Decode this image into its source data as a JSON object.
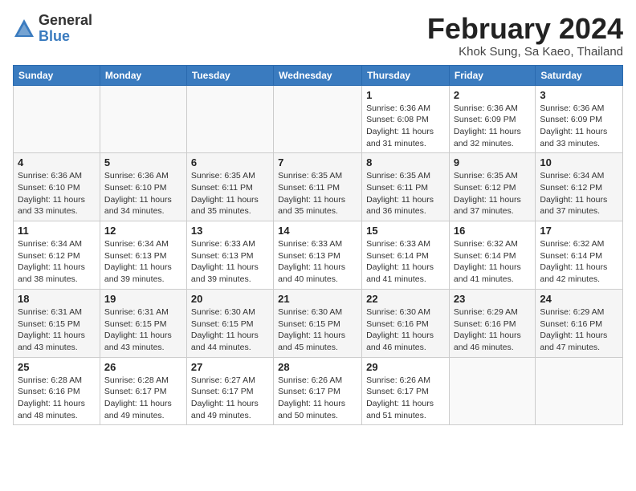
{
  "logo": {
    "general": "General",
    "blue": "Blue"
  },
  "title": {
    "month_year": "February 2024",
    "location": "Khok Sung, Sa Kaeo, Thailand"
  },
  "headers": [
    "Sunday",
    "Monday",
    "Tuesday",
    "Wednesday",
    "Thursday",
    "Friday",
    "Saturday"
  ],
  "weeks": [
    [
      {
        "day": "",
        "info": ""
      },
      {
        "day": "",
        "info": ""
      },
      {
        "day": "",
        "info": ""
      },
      {
        "day": "",
        "info": ""
      },
      {
        "day": "1",
        "info": "Sunrise: 6:36 AM\nSunset: 6:08 PM\nDaylight: 11 hours\nand 31 minutes."
      },
      {
        "day": "2",
        "info": "Sunrise: 6:36 AM\nSunset: 6:09 PM\nDaylight: 11 hours\nand 32 minutes."
      },
      {
        "day": "3",
        "info": "Sunrise: 6:36 AM\nSunset: 6:09 PM\nDaylight: 11 hours\nand 33 minutes."
      }
    ],
    [
      {
        "day": "4",
        "info": "Sunrise: 6:36 AM\nSunset: 6:10 PM\nDaylight: 11 hours\nand 33 minutes."
      },
      {
        "day": "5",
        "info": "Sunrise: 6:36 AM\nSunset: 6:10 PM\nDaylight: 11 hours\nand 34 minutes."
      },
      {
        "day": "6",
        "info": "Sunrise: 6:35 AM\nSunset: 6:11 PM\nDaylight: 11 hours\nand 35 minutes."
      },
      {
        "day": "7",
        "info": "Sunrise: 6:35 AM\nSunset: 6:11 PM\nDaylight: 11 hours\nand 35 minutes."
      },
      {
        "day": "8",
        "info": "Sunrise: 6:35 AM\nSunset: 6:11 PM\nDaylight: 11 hours\nand 36 minutes."
      },
      {
        "day": "9",
        "info": "Sunrise: 6:35 AM\nSunset: 6:12 PM\nDaylight: 11 hours\nand 37 minutes."
      },
      {
        "day": "10",
        "info": "Sunrise: 6:34 AM\nSunset: 6:12 PM\nDaylight: 11 hours\nand 37 minutes."
      }
    ],
    [
      {
        "day": "11",
        "info": "Sunrise: 6:34 AM\nSunset: 6:12 PM\nDaylight: 11 hours\nand 38 minutes."
      },
      {
        "day": "12",
        "info": "Sunrise: 6:34 AM\nSunset: 6:13 PM\nDaylight: 11 hours\nand 39 minutes."
      },
      {
        "day": "13",
        "info": "Sunrise: 6:33 AM\nSunset: 6:13 PM\nDaylight: 11 hours\nand 39 minutes."
      },
      {
        "day": "14",
        "info": "Sunrise: 6:33 AM\nSunset: 6:13 PM\nDaylight: 11 hours\nand 40 minutes."
      },
      {
        "day": "15",
        "info": "Sunrise: 6:33 AM\nSunset: 6:14 PM\nDaylight: 11 hours\nand 41 minutes."
      },
      {
        "day": "16",
        "info": "Sunrise: 6:32 AM\nSunset: 6:14 PM\nDaylight: 11 hours\nand 41 minutes."
      },
      {
        "day": "17",
        "info": "Sunrise: 6:32 AM\nSunset: 6:14 PM\nDaylight: 11 hours\nand 42 minutes."
      }
    ],
    [
      {
        "day": "18",
        "info": "Sunrise: 6:31 AM\nSunset: 6:15 PM\nDaylight: 11 hours\nand 43 minutes."
      },
      {
        "day": "19",
        "info": "Sunrise: 6:31 AM\nSunset: 6:15 PM\nDaylight: 11 hours\nand 43 minutes."
      },
      {
        "day": "20",
        "info": "Sunrise: 6:30 AM\nSunset: 6:15 PM\nDaylight: 11 hours\nand 44 minutes."
      },
      {
        "day": "21",
        "info": "Sunrise: 6:30 AM\nSunset: 6:15 PM\nDaylight: 11 hours\nand 45 minutes."
      },
      {
        "day": "22",
        "info": "Sunrise: 6:30 AM\nSunset: 6:16 PM\nDaylight: 11 hours\nand 46 minutes."
      },
      {
        "day": "23",
        "info": "Sunrise: 6:29 AM\nSunset: 6:16 PM\nDaylight: 11 hours\nand 46 minutes."
      },
      {
        "day": "24",
        "info": "Sunrise: 6:29 AM\nSunset: 6:16 PM\nDaylight: 11 hours\nand 47 minutes."
      }
    ],
    [
      {
        "day": "25",
        "info": "Sunrise: 6:28 AM\nSunset: 6:16 PM\nDaylight: 11 hours\nand 48 minutes."
      },
      {
        "day": "26",
        "info": "Sunrise: 6:28 AM\nSunset: 6:17 PM\nDaylight: 11 hours\nand 49 minutes."
      },
      {
        "day": "27",
        "info": "Sunrise: 6:27 AM\nSunset: 6:17 PM\nDaylight: 11 hours\nand 49 minutes."
      },
      {
        "day": "28",
        "info": "Sunrise: 6:26 AM\nSunset: 6:17 PM\nDaylight: 11 hours\nand 50 minutes."
      },
      {
        "day": "29",
        "info": "Sunrise: 6:26 AM\nSunset: 6:17 PM\nDaylight: 11 hours\nand 51 minutes."
      },
      {
        "day": "",
        "info": ""
      },
      {
        "day": "",
        "info": ""
      }
    ]
  ]
}
